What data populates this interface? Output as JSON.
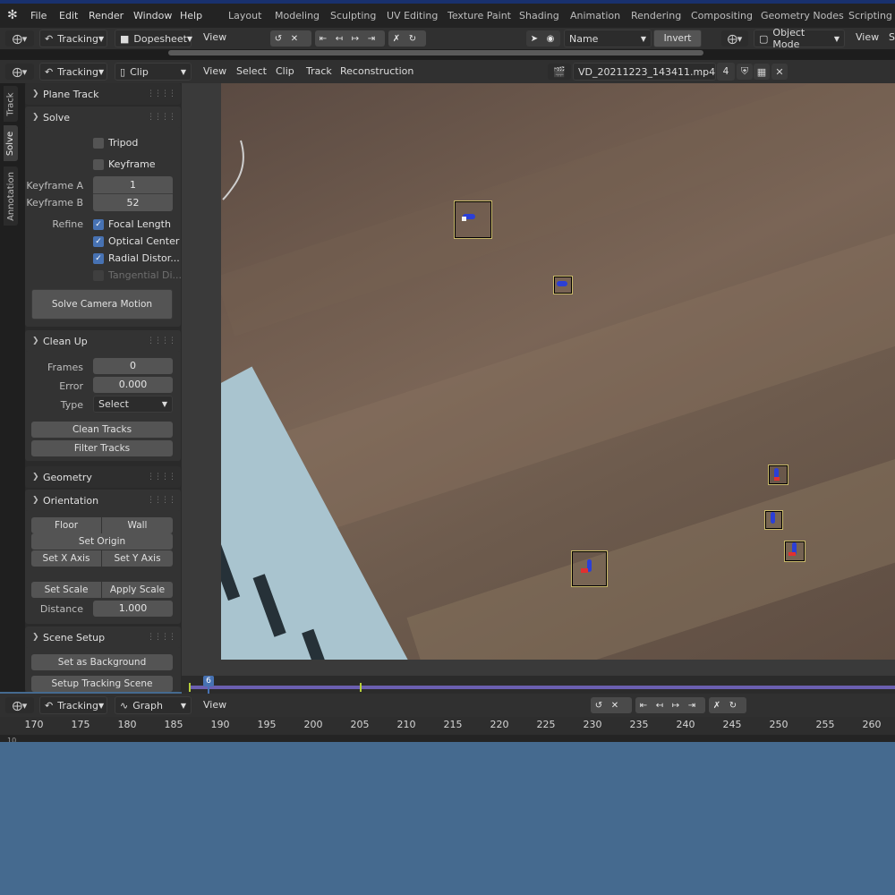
{
  "top_menu": {
    "items": [
      "File",
      "Edit",
      "Render",
      "Window",
      "Help"
    ],
    "workspaces": [
      "Layout",
      "Modeling",
      "Sculpting",
      "UV Editing",
      "Texture Paint",
      "Shading",
      "Animation",
      "Rendering",
      "Compositing",
      "Geometry Nodes",
      "Scripting"
    ]
  },
  "dopesheet_header": {
    "mode": "Tracking",
    "editor": "Dopesheet",
    "view": "View",
    "filter_field": "Name",
    "invert": "Invert",
    "object_mode": "Object Mode",
    "view2": "View",
    "cut": "S"
  },
  "clip_header": {
    "mode": "Tracking",
    "editor": "Clip",
    "menus": [
      "View",
      "Select",
      "Clip",
      "Track",
      "Reconstruction"
    ],
    "clip_name": "VD_20211223_143411.mp4",
    "users": "4"
  },
  "tabs": [
    "Track",
    "Solve",
    "Annotation"
  ],
  "plane_track": {
    "title": "Plane Track"
  },
  "solve": {
    "title": "Solve",
    "tripod": "Tripod",
    "keyframe": "Keyframe",
    "keyframe_a_label": "Keyframe A",
    "keyframe_a": "1",
    "keyframe_b_label": "Keyframe B",
    "keyframe_b": "52",
    "refine_label": "Refine",
    "refine": [
      "Focal Length",
      "Optical Center",
      "Radial Distor...",
      "Tangential Di..."
    ],
    "solve_button": "Solve Camera Motion"
  },
  "cleanup": {
    "title": "Clean Up",
    "frames_label": "Frames",
    "frames": "0",
    "error_label": "Error",
    "error": "0.000",
    "type_label": "Type",
    "type": "Select",
    "clean_button": "Clean Tracks",
    "filter_button": "Filter Tracks"
  },
  "geometry": {
    "title": "Geometry"
  },
  "orientation": {
    "title": "Orientation",
    "floor": "Floor",
    "wall": "Wall",
    "set_origin": "Set Origin",
    "set_x": "Set X Axis",
    "set_y": "Set Y Axis",
    "set_scale": "Set Scale",
    "apply_scale": "Apply Scale",
    "distance_label": "Distance",
    "distance": "1.000"
  },
  "scene_setup": {
    "title": "Scene Setup",
    "bg_button": "Set as Background",
    "setup_button": "Setup Tracking Scene"
  },
  "timeline": {
    "current_frame": "6"
  },
  "graph_header": {
    "mode": "Tracking",
    "editor": "Graph",
    "view": "View"
  },
  "graph_ticks": [
    "170",
    "175",
    "180",
    "185",
    "190",
    "195",
    "200",
    "205",
    "210",
    "215",
    "220",
    "225",
    "230",
    "235",
    "240",
    "245",
    "250",
    "255",
    "260"
  ],
  "graph_fragment": "10",
  "colors": {
    "accent": "#4772b3",
    "selection_blue": "#3f7ad6",
    "timeline_marker": "#b6cf3a",
    "track_outline": "#c9b96a"
  }
}
